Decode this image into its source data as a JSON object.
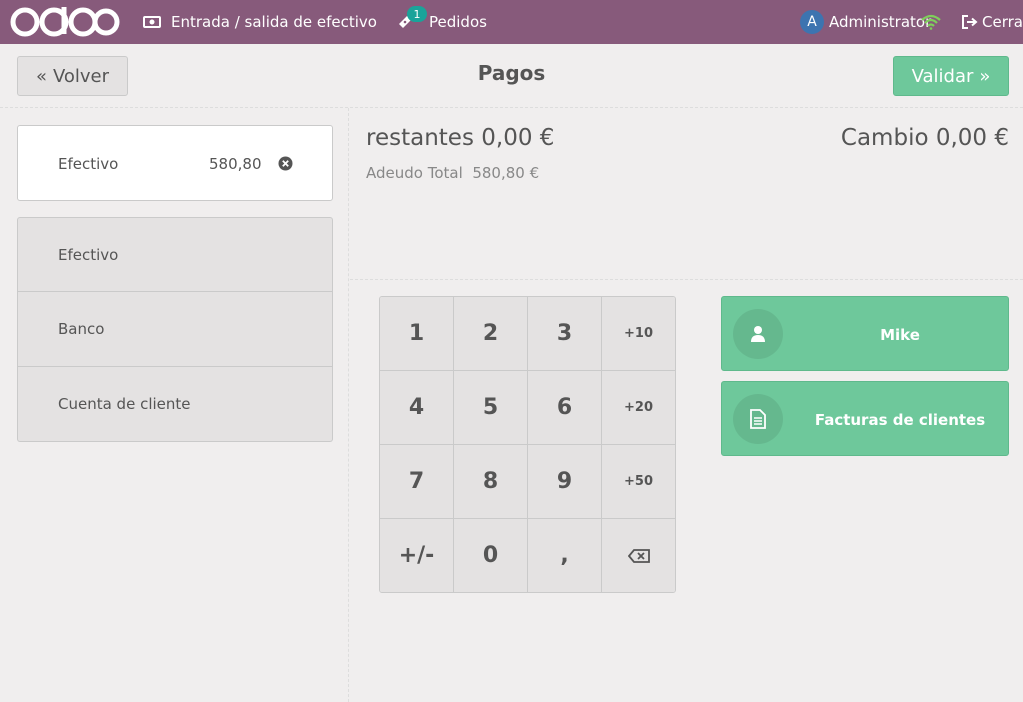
{
  "topbar": {
    "logo": "odoo",
    "cash_label": "Entrada / salida de efectivo",
    "orders_badge": "1",
    "orders_label": "Pedidos",
    "user_initial": "A",
    "user_name": "Administrator",
    "logout_label": "Cerrar"
  },
  "header": {
    "back_label": "Volver",
    "title": "Pagos",
    "validate_label": "Validar"
  },
  "paymentline": {
    "method": "Efectivo",
    "amount": "580,80"
  },
  "methods": [
    "Efectivo",
    "Banco",
    "Cuenta de cliente"
  ],
  "summary": {
    "remaining_label": "restantes",
    "remaining_value": "0,00 €",
    "change_label": "Cambio",
    "change_value": "0,00 €",
    "total_label": "Adeudo Total",
    "total_value": "580,80 €"
  },
  "numpad": [
    "1",
    "2",
    "3",
    "+10",
    "4",
    "5",
    "6",
    "+20",
    "7",
    "8",
    "9",
    "+50",
    "+/-",
    "0",
    ","
  ],
  "client_button": "Mike",
  "invoice_button": "Facturas de clientes",
  "colors": {
    "brand": "#875a7b",
    "accent": "#6ec89b",
    "badge": "#1aa39a"
  }
}
